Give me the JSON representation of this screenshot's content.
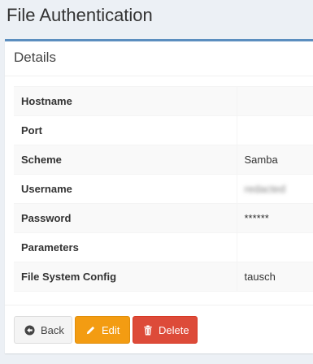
{
  "page": {
    "title": "File Authentication"
  },
  "panel": {
    "heading": "Details"
  },
  "details": [
    {
      "label": "Hostname",
      "value": ""
    },
    {
      "label": "Port",
      "value": ""
    },
    {
      "label": "Scheme",
      "value": "Samba"
    },
    {
      "label": "Username",
      "value": "redacted"
    },
    {
      "label": "Password",
      "value": "******"
    },
    {
      "label": "Parameters",
      "value": ""
    },
    {
      "label": "File System Config",
      "value": "tausch"
    }
  ],
  "buttons": {
    "back": "Back",
    "edit": "Edit",
    "delete": "Delete"
  },
  "colors": {
    "accent_border": "#5b8ebf",
    "warning": "#f39c12",
    "danger": "#dd4b39",
    "background": "#ecf0f5"
  },
  "icons": {
    "back": "circle-arrow-left-icon",
    "edit": "pencil-icon",
    "delete": "trash-icon"
  }
}
